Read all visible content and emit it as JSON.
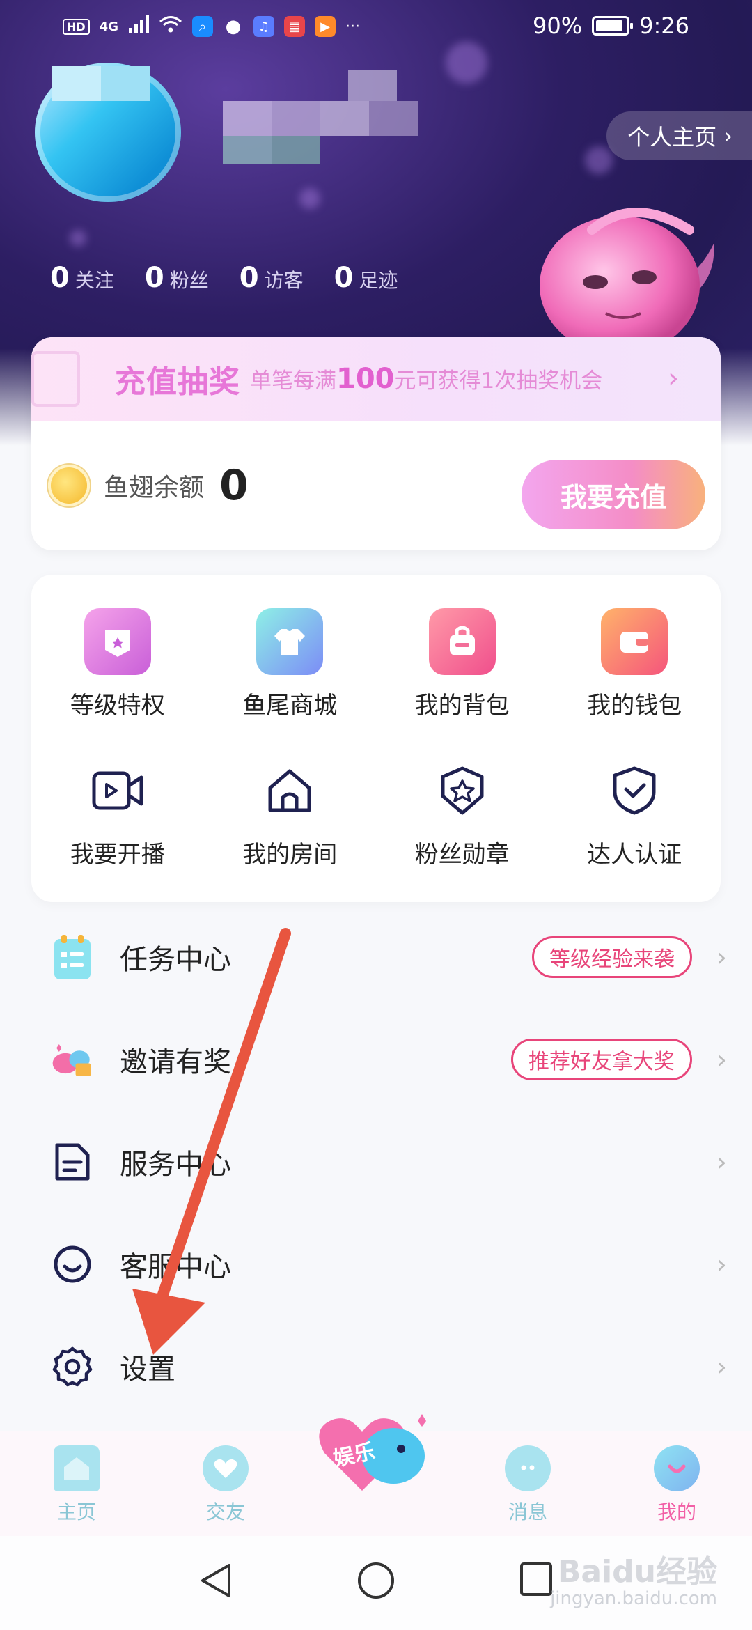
{
  "status_bar": {
    "network_badge": "HD",
    "network_type": "4G",
    "more": "···",
    "battery_percent": "90%",
    "time": "9:26"
  },
  "profile": {
    "profile_link": "个人主页",
    "stats": [
      {
        "value": "0",
        "label": "关注"
      },
      {
        "value": "0",
        "label": "粉丝"
      },
      {
        "value": "0",
        "label": "访客"
      },
      {
        "value": "0",
        "label": "足迹"
      }
    ]
  },
  "recharge": {
    "promo_title": "充值抽奖",
    "promo_desc_prefix": "单笔每满",
    "promo_amount": "100",
    "promo_desc_suffix": "元可获得1次抽奖机会",
    "balance_label": "鱼翅余额",
    "balance_value": "0",
    "button_label": "我要充值"
  },
  "grid": {
    "row1": [
      {
        "label": "等级特权",
        "icon": "level-privilege-icon"
      },
      {
        "label": "鱼尾商城",
        "icon": "shop-shirt-icon"
      },
      {
        "label": "我的背包",
        "icon": "backpack-icon"
      },
      {
        "label": "我的钱包",
        "icon": "wallet-icon"
      }
    ],
    "row2": [
      {
        "label": "我要开播",
        "icon": "video-camera-icon"
      },
      {
        "label": "我的房间",
        "icon": "house-icon"
      },
      {
        "label": "粉丝勋章",
        "icon": "star-badge-icon"
      },
      {
        "label": "达人认证",
        "icon": "shield-check-icon"
      }
    ]
  },
  "list": [
    {
      "label": "任务中心",
      "badge": "等级经验来袭",
      "icon": "task-list-icon"
    },
    {
      "label": "邀请有奖",
      "badge": "推荐好友拿大奖",
      "icon": "invite-gift-icon"
    },
    {
      "label": "服务中心",
      "badge": "",
      "icon": "service-document-icon"
    },
    {
      "label": "客服中心",
      "badge": "",
      "icon": "customer-service-icon"
    },
    {
      "label": "设置",
      "badge": "",
      "icon": "gear-icon"
    }
  ],
  "bottom_nav": {
    "items": [
      {
        "label": "主页",
        "icon": "home-icon"
      },
      {
        "label": "交友",
        "icon": "heart-icon"
      },
      {
        "label": "消息",
        "icon": "message-icon"
      },
      {
        "label": "我的",
        "icon": "profile-icon"
      }
    ],
    "center_badge": "娱乐"
  },
  "watermark": {
    "brand": "Baidu经验",
    "url": "jingyan.baidu.com"
  },
  "colors": {
    "header_bg": "#2d1e63",
    "accent_pink": "#e8457a",
    "promo_pink": "#e777d8",
    "nav_teal": "#a9e3ef",
    "annotation_arrow": "#e8553f"
  }
}
